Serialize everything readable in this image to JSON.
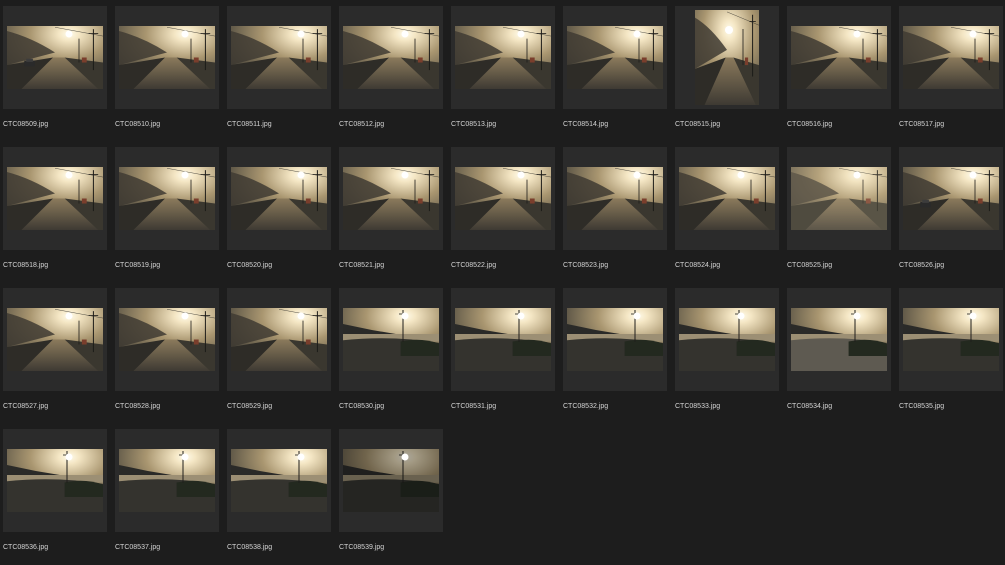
{
  "gallery": {
    "items": [
      {
        "filename": "CTC08509.jpg",
        "orientation": "landscape",
        "scene": "road-car"
      },
      {
        "filename": "CTC08510.jpg",
        "orientation": "landscape",
        "scene": "road-sun"
      },
      {
        "filename": "CTC08511.jpg",
        "orientation": "landscape",
        "scene": "road-sun"
      },
      {
        "filename": "CTC08512.jpg",
        "orientation": "landscape",
        "scene": "road-sun"
      },
      {
        "filename": "CTC08513.jpg",
        "orientation": "landscape",
        "scene": "road-sun"
      },
      {
        "filename": "CTC08514.jpg",
        "orientation": "landscape",
        "scene": "road-sun"
      },
      {
        "filename": "CTC08515.jpg",
        "orientation": "portrait",
        "scene": "road-sun"
      },
      {
        "filename": "CTC08516.jpg",
        "orientation": "landscape",
        "scene": "road-sun"
      },
      {
        "filename": "CTC08517.jpg",
        "orientation": "landscape",
        "scene": "road-sun"
      },
      {
        "filename": "CTC08518.jpg",
        "orientation": "landscape",
        "scene": "road-sun"
      },
      {
        "filename": "CTC08519.jpg",
        "orientation": "landscape",
        "scene": "road-sun"
      },
      {
        "filename": "CTC08520.jpg",
        "orientation": "landscape",
        "scene": "road-sun"
      },
      {
        "filename": "CTC08521.jpg",
        "orientation": "landscape",
        "scene": "road-sun"
      },
      {
        "filename": "CTC08522.jpg",
        "orientation": "landscape",
        "scene": "road-sun"
      },
      {
        "filename": "CTC08523.jpg",
        "orientation": "landscape",
        "scene": "road-sun"
      },
      {
        "filename": "CTC08524.jpg",
        "orientation": "landscape",
        "scene": "road-sun"
      },
      {
        "filename": "CTC08525.jpg",
        "orientation": "landscape",
        "scene": "road-bright"
      },
      {
        "filename": "CTC08526.jpg",
        "orientation": "landscape",
        "scene": "road-car"
      },
      {
        "filename": "CTC08527.jpg",
        "orientation": "landscape",
        "scene": "road-sun"
      },
      {
        "filename": "CTC08528.jpg",
        "orientation": "landscape",
        "scene": "road-sun"
      },
      {
        "filename": "CTC08529.jpg",
        "orientation": "landscape",
        "scene": "road-sun"
      },
      {
        "filename": "CTC08530.jpg",
        "orientation": "landscape",
        "scene": "coast"
      },
      {
        "filename": "CTC08531.jpg",
        "orientation": "landscape",
        "scene": "coast"
      },
      {
        "filename": "CTC08532.jpg",
        "orientation": "landscape",
        "scene": "coast"
      },
      {
        "filename": "CTC08533.jpg",
        "orientation": "landscape",
        "scene": "coast"
      },
      {
        "filename": "CTC08534.jpg",
        "orientation": "landscape",
        "scene": "coast-gravel"
      },
      {
        "filename": "CTC08535.jpg",
        "orientation": "landscape",
        "scene": "coast"
      },
      {
        "filename": "CTC08536.jpg",
        "orientation": "landscape",
        "scene": "coast"
      },
      {
        "filename": "CTC08537.jpg",
        "orientation": "landscape",
        "scene": "coast"
      },
      {
        "filename": "CTC08538.jpg",
        "orientation": "landscape",
        "scene": "coast"
      },
      {
        "filename": "CTC08539.jpg",
        "orientation": "landscape",
        "scene": "coast-dark"
      }
    ]
  },
  "colors": {
    "background": "#1d1d1d",
    "tile": "#2b2b2b",
    "filename_text": "#d4d4d4"
  }
}
